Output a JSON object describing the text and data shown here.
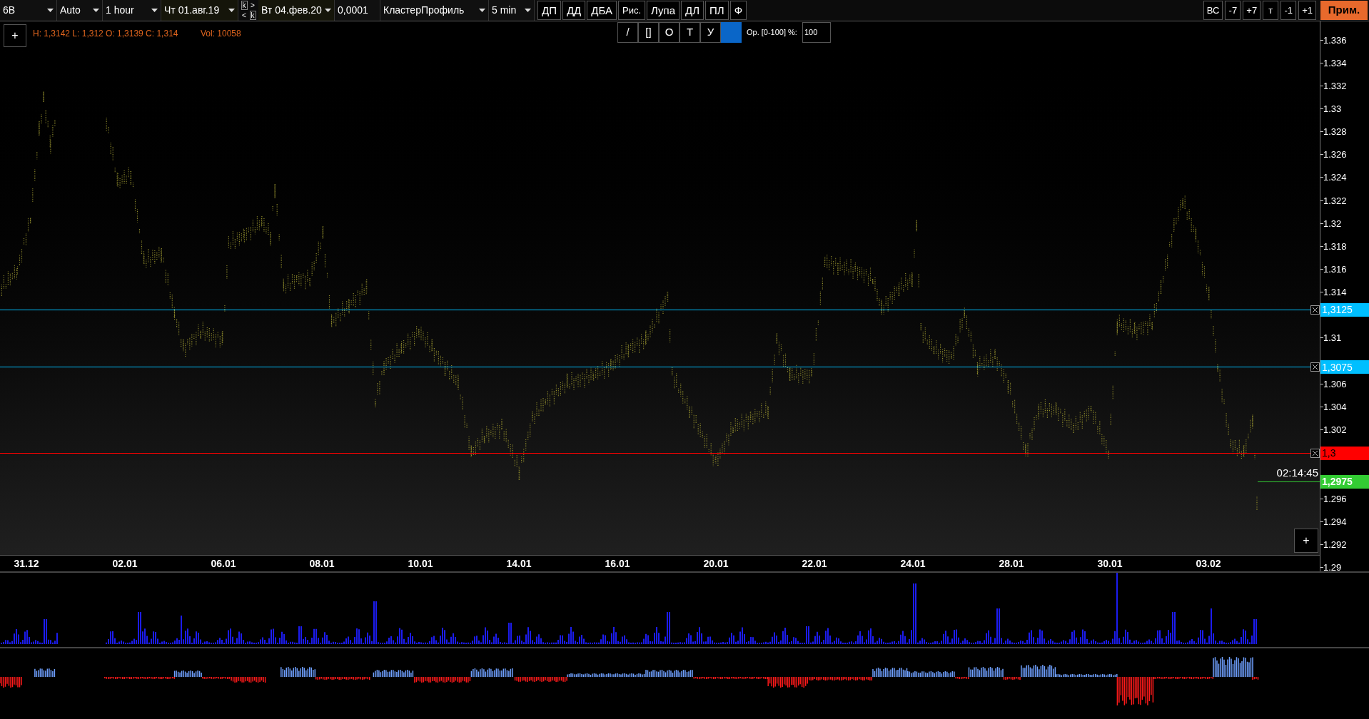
{
  "toolbar": {
    "selects": [
      {
        "kind": "select",
        "value": "6B"
      },
      {
        "kind": "select",
        "value": "Auto"
      },
      {
        "kind": "select",
        "value": "1 hour"
      },
      {
        "kind": "date",
        "value": "Чт 01.авг.19"
      },
      {
        "kind": "nav"
      },
      {
        "kind": "date",
        "value": "Вт 04.фев.20"
      },
      {
        "kind": "field",
        "value": "0,0001"
      },
      {
        "kind": "select",
        "value": "КластерПрофиль"
      },
      {
        "kind": "select",
        "value": "5 min"
      }
    ],
    "nav_buttons": [
      {
        "kind": "boxed",
        "label": "k"
      },
      {
        "kind": "plain",
        "label": ">"
      },
      {
        "kind": "plain",
        "label": "<"
      },
      {
        "kind": "boxed",
        "label": "k"
      }
    ],
    "buttons": [
      "ДП",
      "ДД",
      "ДБА",
      "Рис.",
      "Лупа",
      "ДЛ",
      "ПЛ",
      "Ф"
    ],
    "right_buttons": [
      "ВС",
      "-7",
      "+7",
      "т",
      "-1",
      "+1"
    ],
    "apply_button": "Прим."
  },
  "chart": {
    "add_button": "+",
    "ohlc_text": "H: 1,3142 L: 1,312 O: 1,3139 C: 1,314",
    "volume_text": "Vol: 10058",
    "drawing_tools": [
      "/",
      "[]",
      "О",
      "Т",
      "У"
    ],
    "opacity_label": "Ор. [0-100] %:",
    "opacity_value": "100",
    "corner_button": "+",
    "price_ticks": [
      "1.336",
      "1.334",
      "1.332",
      "1.33",
      "1.328",
      "1.326",
      "1.324",
      "1.322",
      "1.32",
      "1.318",
      "1.316",
      "1.314",
      "1.31",
      "1.306",
      "1.304",
      "1.302",
      "1.296",
      "1.294",
      "1.292",
      "1.29"
    ],
    "levels": [
      {
        "kind": "line",
        "label": "1,3125",
        "color": "#00bfff"
      },
      {
        "kind": "line",
        "label": "1,3075",
        "color": "#00bfff"
      },
      {
        "kind": "line",
        "label": "1,3",
        "color": "#ff0000"
      },
      {
        "kind": "current",
        "label": "1,2975",
        "color": "#33cc33",
        "timer": "02:14:45"
      }
    ],
    "dates": [
      "31.12",
      "02.01",
      "06.01",
      "08.01",
      "10.01",
      "14.01",
      "16.01",
      "20.01",
      "22.01",
      "24.01",
      "28.01",
      "30.01",
      "03.02"
    ]
  }
}
